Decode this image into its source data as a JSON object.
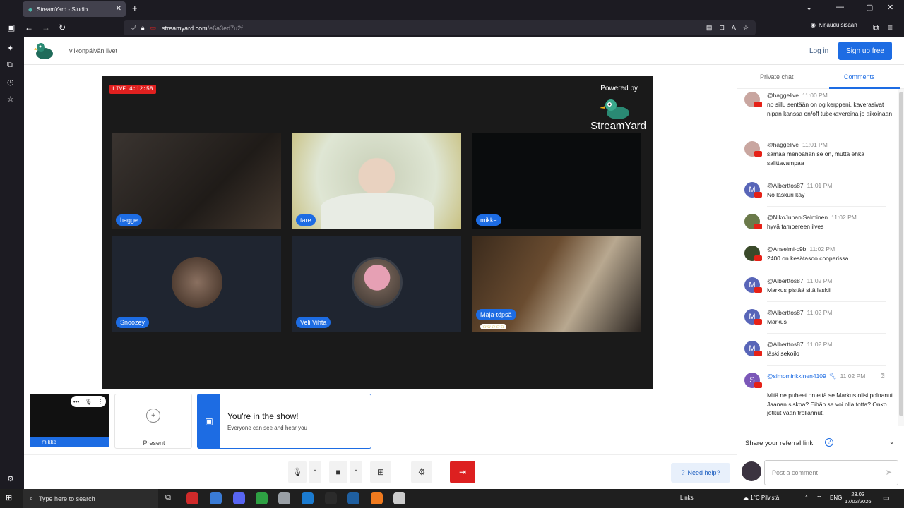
{
  "browser": {
    "tab_title": "StreamYard - Studio",
    "url_host": "streamyard.com",
    "url_path": "/e6a3ed7u2f",
    "account_label": "Kirjaudu sisään"
  },
  "header": {
    "broadcast_title": "viikonpäivän livet",
    "login": "Log in",
    "signup": "Sign up free"
  },
  "stage": {
    "live_badge": "LIVE 4:12:58",
    "powered_by": "Powered by",
    "brand": "StreamYard",
    "participants": [
      {
        "name": "hagge"
      },
      {
        "name": "tare"
      },
      {
        "name": "mikke"
      },
      {
        "name": "Snoozey"
      },
      {
        "name": "Veli Vihta"
      },
      {
        "name": "Maja-töpsä",
        "stars": "☆☆☆☆☆"
      }
    ]
  },
  "self_view": {
    "name": "mikke"
  },
  "present": {
    "label": "Present"
  },
  "notice": {
    "title": "You're in the show!",
    "subtitle": "Everyone can see and hear you"
  },
  "toolbar": {
    "help": "Need help?"
  },
  "panel": {
    "tab_private": "Private chat",
    "tab_comments": "Comments",
    "referral": "Share your referral link",
    "comment_placeholder": "Post a comment",
    "comments": [
      {
        "author": "@haggelive",
        "time": "11:00 PM",
        "text": "no sillu sentään on og kerppeni, kaverasivat nipan kanssa on/off tubekavereina jo aikoinaan",
        "avatar": "",
        "color": "#c9a6a0"
      },
      {
        "author": "@haggelive",
        "time": "11:01 PM",
        "text": "samaa menoahan se on, mutta ehkä salittavampaa",
        "avatar": "",
        "color": "#c9a6a0"
      },
      {
        "author": "@Alberttos87",
        "time": "11:01 PM",
        "text": "No laskuri käy",
        "avatar": "M",
        "color": "#5865b8"
      },
      {
        "author": "@NikoJuhaniSalminen",
        "time": "11:02 PM",
        "text": "hyvä tampereen ilves",
        "avatar": "",
        "color": "#6b7a4a"
      },
      {
        "author": "@Anselmi-c9b",
        "time": "11:02 PM",
        "text": "2400 on kesätasoo cooperissa",
        "avatar": "",
        "color": "#3a4a2a"
      },
      {
        "author": "@Alberttos87",
        "time": "11:02 PM",
        "text": "Markus pistää sitä laskii",
        "avatar": "M",
        "color": "#5865b8"
      },
      {
        "author": "@Alberttos87",
        "time": "11:02 PM",
        "text": "Markus",
        "avatar": "M",
        "color": "#5865b8"
      },
      {
        "author": "@Alberttos87",
        "time": "11:02 PM",
        "text": "läski sekoilo",
        "avatar": "M",
        "color": "#5865b8"
      },
      {
        "author": "@simominkkinen4109",
        "time": "11:02 PM",
        "text": "Mitä ne puheet on että se Markus olisi polnanut Jaanan siskoa? Eihän se voi olla totta? Onko jotkut vaan trollannut.",
        "avatar": "S",
        "color": "#7b57b8"
      }
    ]
  },
  "taskbar": {
    "search": "Type here to search",
    "links": "Links",
    "weather": "1°C Pilvistä",
    "lang": "ENG",
    "time": "23.03",
    "date": "17/03/2026"
  }
}
